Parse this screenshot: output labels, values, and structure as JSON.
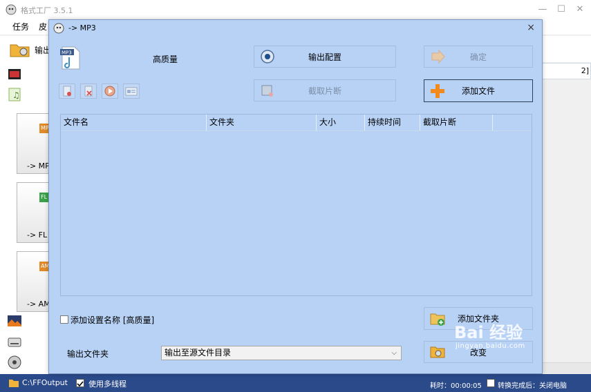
{
  "app": {
    "title": "格式工厂 3.5.1"
  },
  "menu": {
    "items": [
      "任务",
      "皮"
    ]
  },
  "toolbar": {
    "output_label": "输出"
  },
  "left_cards": [
    {
      "label": "-> MP",
      "fmt": "MP",
      "fmt_color": "#e08a2a"
    },
    {
      "label": "-> FL",
      "fmt": "FL",
      "fmt_color": "#3aa24a"
    },
    {
      "label": "-> AM",
      "fmt": "AM",
      "fmt_color": "#e08a2a"
    }
  ],
  "right_edge": {
    "text": "2]"
  },
  "status": {
    "path": "C:\\FFOutput",
    "multithread_label": "使用多线程",
    "elapsed": "耗时：00:00:05",
    "shutdown_label": "转换完成后：关闭电脑"
  },
  "dialog": {
    "title": "-> MP3",
    "close": "×",
    "preset_icon_text": "MP3",
    "quality": "高质量",
    "buttons": {
      "output_config": "输出配置",
      "confirm": "确定",
      "cut": "截取片断",
      "add_file": "添加文件",
      "add_folder": "添加文件夹",
      "change": "改变"
    },
    "table_headers": [
      "文件名",
      "文件夹",
      "大小",
      "持续时间",
      "截取片断"
    ],
    "add_name_label": "添加设置名称 [高质量]",
    "output_folder_label": "输出文件夹",
    "output_folder_value": "输出至源文件目录"
  },
  "watermark": {
    "big": "Bai 经验",
    "small": "jingyan.baidu.com"
  },
  "colors": {
    "dialog_bg": "#b8d2f6",
    "status_bg": "#2b4a8a",
    "accent_orange": "#f28a1e"
  }
}
